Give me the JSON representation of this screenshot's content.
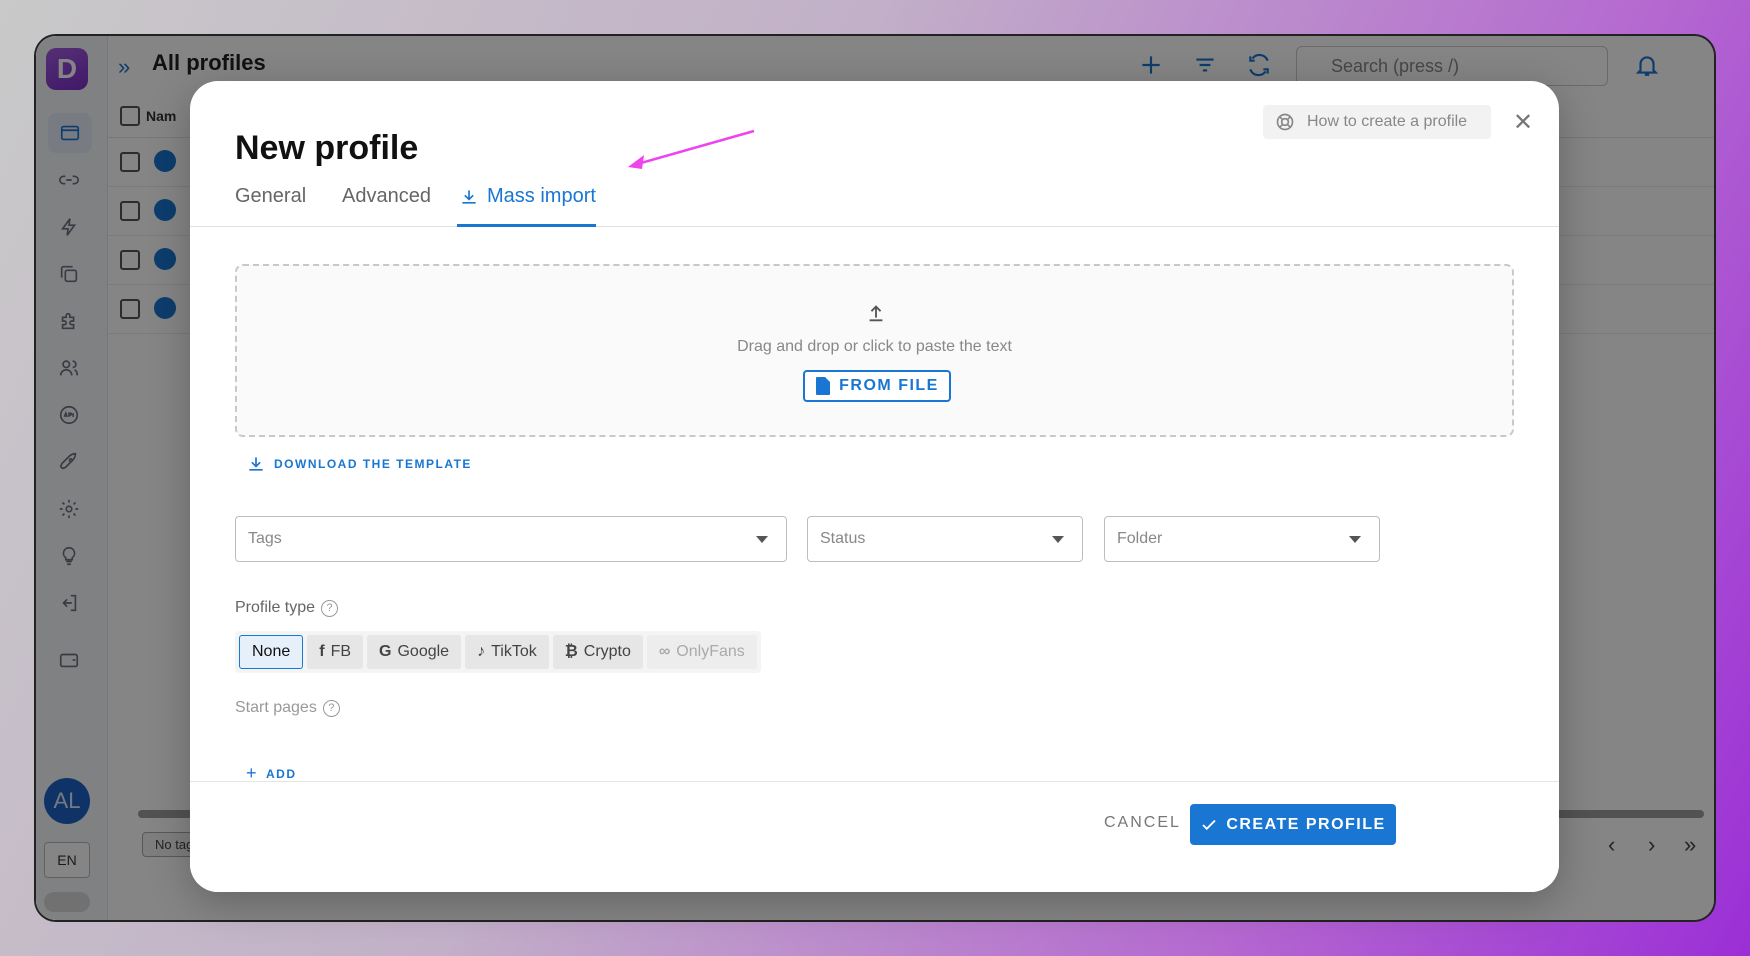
{
  "app": {
    "logo_letter": "D",
    "page_title": "All profiles",
    "search_placeholder": "Search (press /)",
    "table_header_name": "Nam",
    "avatar_initials": "AL",
    "language": "EN",
    "no_tags": "No tags"
  },
  "modal": {
    "title": "New profile",
    "help_button": "How to create a profile",
    "tabs": [
      {
        "label": "General"
      },
      {
        "label": "Advanced"
      },
      {
        "label": "Mass import"
      }
    ],
    "dropzone": {
      "text": "Drag and drop or click to paste the text",
      "from_file": "FROM FILE"
    },
    "download_template": "DOWNLOAD THE TEMPLATE",
    "selects": {
      "tags": "Tags",
      "status": "Status",
      "folder": "Folder"
    },
    "profile_type": {
      "label": "Profile type",
      "options": [
        "None",
        "FB",
        "Google",
        "TikTok",
        "Crypto",
        "OnlyFans"
      ],
      "selected": "None"
    },
    "start_pages": {
      "label": "Start pages",
      "add": "ADD"
    },
    "footer": {
      "cancel": "CANCEL",
      "create": "CREATE PROFILE"
    }
  },
  "colors": {
    "accent": "#1976d2",
    "logo": "#8a3fd4",
    "annotation_arrow": "#ee44ee"
  }
}
